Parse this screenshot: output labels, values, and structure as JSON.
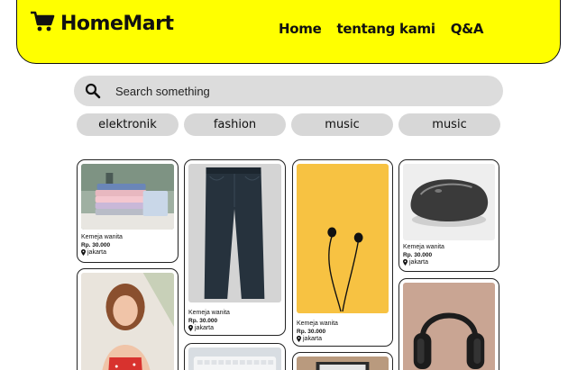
{
  "brand": {
    "name": "HomeMart",
    "logo_icon": "shopping-cart-icon"
  },
  "nav": [
    {
      "label": "Home"
    },
    {
      "label": "tentang kami"
    },
    {
      "label": "Q&A"
    }
  ],
  "search": {
    "placeholder": "Search something",
    "icon": "search-icon"
  },
  "categories": [
    "elektronik",
    "fashion",
    "music",
    "music"
  ],
  "products": [
    {
      "title": "Kemeja wanita",
      "price": "Rp. 30.000",
      "location": "jakarta",
      "image": "folded-shirts"
    },
    {
      "title": "Kemeja wanita",
      "price": "Rp. 30.000",
      "location": "jakarta",
      "image": "jeans"
    },
    {
      "title": "Kemeja wanita",
      "price": "Rp. 30.000",
      "location": "jakarta",
      "image": "earphones"
    },
    {
      "title": "Kemeja wanita",
      "price": "Rp. 30.000",
      "location": "jakarta",
      "image": "computer-mouse"
    },
    {
      "title": "",
      "price": "",
      "location": "",
      "image": "woman-portrait"
    },
    {
      "title": "",
      "price": "",
      "location": "",
      "image": "keyboard"
    },
    {
      "title": "",
      "price": "",
      "location": "",
      "image": "laptop"
    },
    {
      "title": "",
      "price": "",
      "location": "",
      "image": "headphones"
    }
  ],
  "colors": {
    "header": "#ffff00",
    "chip": "#d7d7d7",
    "search": "#dcdcdc"
  }
}
